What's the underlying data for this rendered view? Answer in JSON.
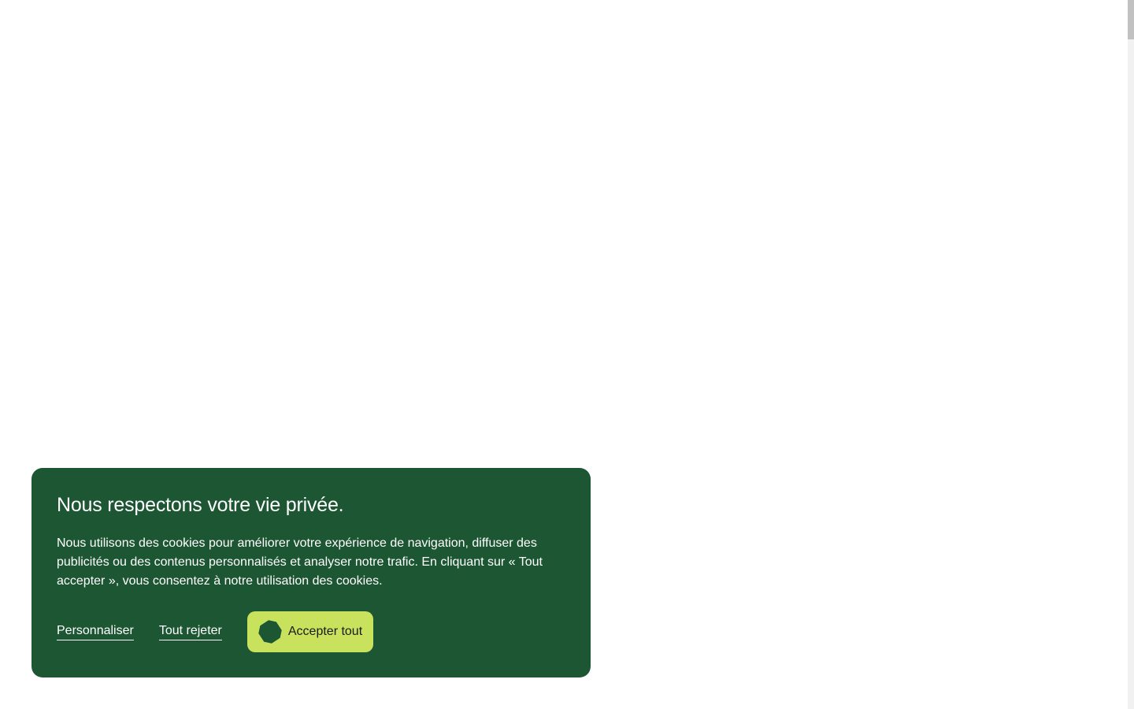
{
  "cookie_banner": {
    "title": "Nous respectons votre vie privée.",
    "text": "Nous utilisons des cookies pour améliorer votre expérience de navigation, diffuser des publicités ou des contenus personnalisés et analyser notre trafic. En cliquant sur « Tout accepter », vous consentez à notre utilisation des cookies.",
    "personalize_label": "Personnaliser",
    "reject_label": "Tout rejeter",
    "accept_label": "Accepter tout",
    "accept_icon": "octagon-icon"
  },
  "colors": {
    "banner_background": "#1c5633",
    "accept_button": "#c8e25e",
    "accept_icon": "#1c5633",
    "text": "#ffffff"
  }
}
